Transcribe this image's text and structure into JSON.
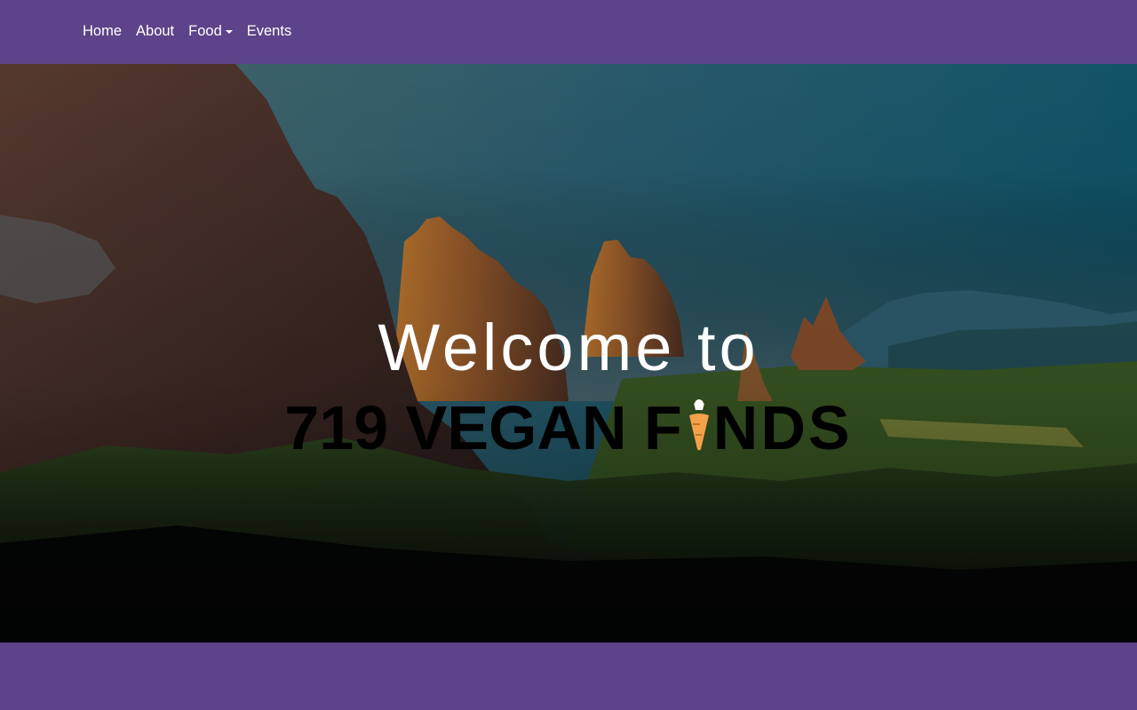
{
  "nav": {
    "items": [
      {
        "label": "Home",
        "icon": null
      },
      {
        "label": "About",
        "icon": null
      },
      {
        "label": "Food",
        "icon": "caret-down-icon"
      },
      {
        "label": "Events",
        "icon": null
      }
    ]
  },
  "hero": {
    "welcome": "Welcome to",
    "brand_prefix": "719 VEGAN",
    "brand_letters_before_icon": "F",
    "brand_icon": "carrot-icon",
    "brand_letters_after_icon": "NDS",
    "background": "Garden of the Gods rock formations at dusk"
  },
  "colors": {
    "brand_purple": "#5d4389",
    "text": "#ffffff",
    "carrot_orange": "#f5a14a"
  }
}
